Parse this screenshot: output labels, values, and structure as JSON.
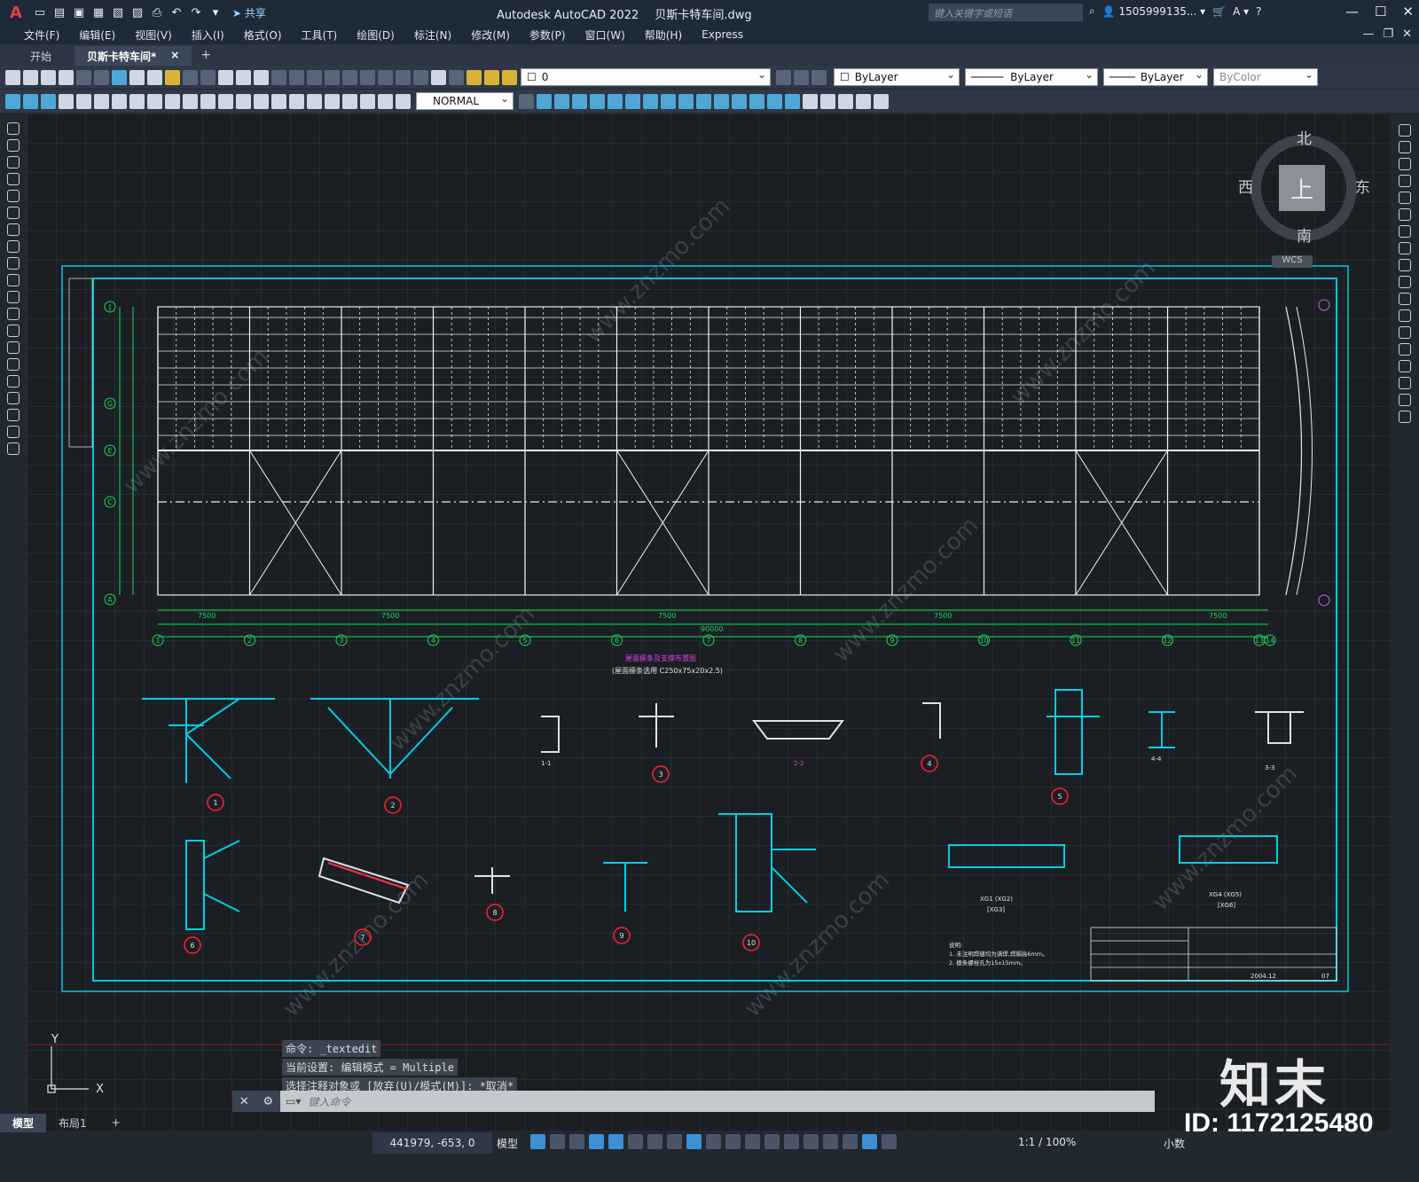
{
  "app": {
    "logo": "A",
    "title": "Autodesk AutoCAD 2022",
    "filename": "贝斯卡特车间.dwg",
    "share": "共享",
    "search_placeholder": "键入关键字或短语",
    "user": "1505999135...",
    "help": "?"
  },
  "menu": [
    "文件(F)",
    "编辑(E)",
    "视图(V)",
    "插入(I)",
    "格式(O)",
    "工具(T)",
    "绘图(D)",
    "标注(N)",
    "修改(M)",
    "参数(P)",
    "窗口(W)",
    "帮助(H)",
    "Express"
  ],
  "tabs": {
    "start": "开始",
    "active": "贝斯卡特车间*",
    "close": "×",
    "add": "+"
  },
  "toolbar": {
    "layer_value": "0",
    "color": "ByLayer",
    "linetype": "ByLayer",
    "lineweight": "ByLayer",
    "plotstyle": "ByColor",
    "textstyle": "NORMAL"
  },
  "viewcube": {
    "north": "北",
    "south": "南",
    "east": "东",
    "west": "西",
    "top": "上",
    "wcs": "WCS"
  },
  "drawing": {
    "grid_labels_bottom": [
      "1",
      "2",
      "3",
      "4",
      "5",
      "6",
      "7",
      "8",
      "9",
      "10",
      "11",
      "12",
      "13",
      "14"
    ],
    "grid_labels_left": [
      "J",
      "G",
      "E",
      "C",
      "A"
    ],
    "bay_dim": "7500",
    "total_dim": "90000",
    "detail_numbers": [
      "1",
      "2",
      "3",
      "4",
      "5",
      "6",
      "7",
      "8",
      "9",
      "10"
    ],
    "section_labels": [
      "1-1",
      "2-2",
      "4-4",
      "3-3"
    ],
    "section_title": "屋面檩条及支撑布置图",
    "purlin_note": "(屋面檩条选用 C250x75x20x2.5)",
    "xg_labels": [
      "XG1 (XG2)",
      "[XG3]",
      "XG4 (XG5)",
      "[XG6]"
    ],
    "notes_title": "说明:",
    "notes": [
      "1. 未注明焊缝均为满焊,焊脚高6mm。",
      "2. 檩条螺栓孔为15x15mm。"
    ],
    "titleblock_date": "2004.12",
    "titleblock_sheet": "07"
  },
  "command": {
    "history": [
      "命令: _textedit",
      "当前设置: 编辑模式 = Multiple",
      "选择注释对象或 [放弃(U)/模式(M)]: *取消*"
    ],
    "prompt": "键入命令"
  },
  "layouts": [
    "模型",
    "布局1",
    "+"
  ],
  "status": {
    "coords": "441979, -653, 0",
    "model": "模型",
    "scale": "1:1 / 100%",
    "units": "小数"
  },
  "watermark": {
    "brand": "知末",
    "id": "ID: 1172125480",
    "site": "www.znzmo.com"
  }
}
